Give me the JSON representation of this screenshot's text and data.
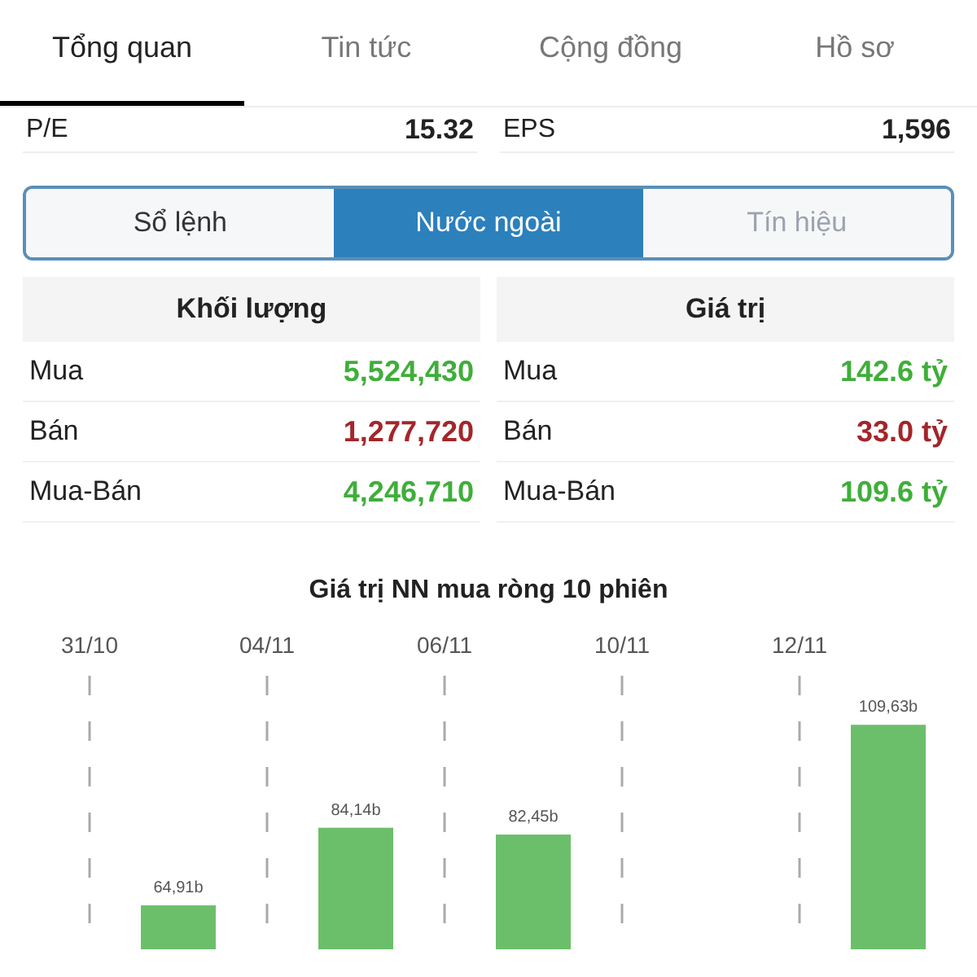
{
  "tabs": [
    {
      "label": "Tổng quan",
      "selected": true
    },
    {
      "label": "Tin tức",
      "selected": false
    },
    {
      "label": "Cộng đồng",
      "selected": false
    },
    {
      "label": "Hồ sơ",
      "selected": false
    }
  ],
  "ratios": [
    {
      "label": "P/E",
      "value": "15.32"
    },
    {
      "label": "EPS",
      "value": "1,596"
    }
  ],
  "segments": [
    {
      "label": "Sổ lệnh",
      "selected": false
    },
    {
      "label": "Nước ngoài",
      "selected": true
    },
    {
      "label": "Tín hiệu",
      "selected": false
    }
  ],
  "tables": [
    {
      "title": "Khối lượng",
      "rows": [
        {
          "label": "Mua",
          "value": "5,524,430",
          "color": "#3fae3a"
        },
        {
          "label": "Bán",
          "value": "1,277,720",
          "color": "#a3262a"
        },
        {
          "label": "Mua-Bán",
          "value": "4,246,710",
          "color": "#3fae3a"
        }
      ]
    },
    {
      "title": "Giá trị",
      "rows": [
        {
          "label": "Mua",
          "value": "142.6 tỷ",
          "color": "#3fae3a"
        },
        {
          "label": "Bán",
          "value": "33.0 tỷ",
          "color": "#a3262a"
        },
        {
          "label": "Mua-Bán",
          "value": "109.6 tỷ",
          "color": "#3fae3a"
        }
      ]
    }
  ],
  "chart": {
    "chart_data": {
      "type": "bar",
      "title": "Giá trị NN mua ròng 10 phiên",
      "categories": [
        "31/10",
        "04/11",
        "06/11",
        "10/11",
        "12/11"
      ],
      "color": "#6cbf6a",
      "values": [
        64.91,
        84.14,
        82.45,
        null,
        109.63
      ],
      "grid": true,
      "value_labels": [
        "64,91b",
        "84,14b",
        "82,45b",
        null,
        "109,63b"
      ]
    }
  }
}
